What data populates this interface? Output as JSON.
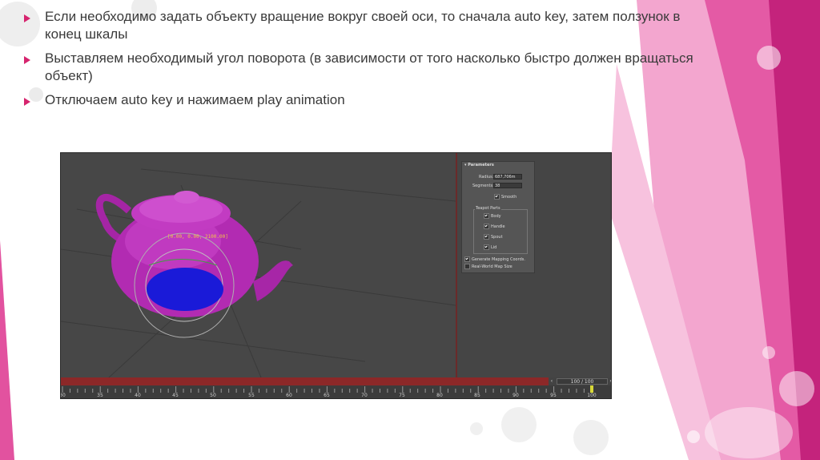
{
  "bullets": [
    "Если необходимо задать объекту вращение вокруг своей оси, то сначала auto key, затем ползунок в конец шкалы",
    "Выставляем необходимый угол поворота (в зависимости от того насколько быстро должен вращаться объект)",
    "Отключаем auto key и нажимаем play animation"
  ],
  "viewport": {
    "coord_readout": "[0.00, 0.00, 2100.00]"
  },
  "parameters": {
    "title": "Parameters",
    "radius_label": "Radius:",
    "radius_value": "687,706m",
    "segments_label": "Segments:",
    "segments_value": "38",
    "smooth_label": "Smooth",
    "teapot_parts_label": "Teapot Parts",
    "body_label": "Body",
    "handle_label": "Handle",
    "spout_label": "Spout",
    "lid_label": "Lid",
    "gen_mapping_label": "Generate Mapping Coords.",
    "real_world_label": "Real-World Map Size"
  },
  "timeline": {
    "frame_display": "100 / 100",
    "ruler_labels": [
      "30",
      "35",
      "40",
      "45",
      "50",
      "55",
      "60",
      "65",
      "70",
      "75",
      "80",
      "85",
      "90",
      "95",
      "100"
    ]
  },
  "colors": {
    "accent": "#d6246e",
    "teapot": "#b82ab8",
    "selection": "#1a1ad8",
    "timeline": "#8c2828"
  }
}
